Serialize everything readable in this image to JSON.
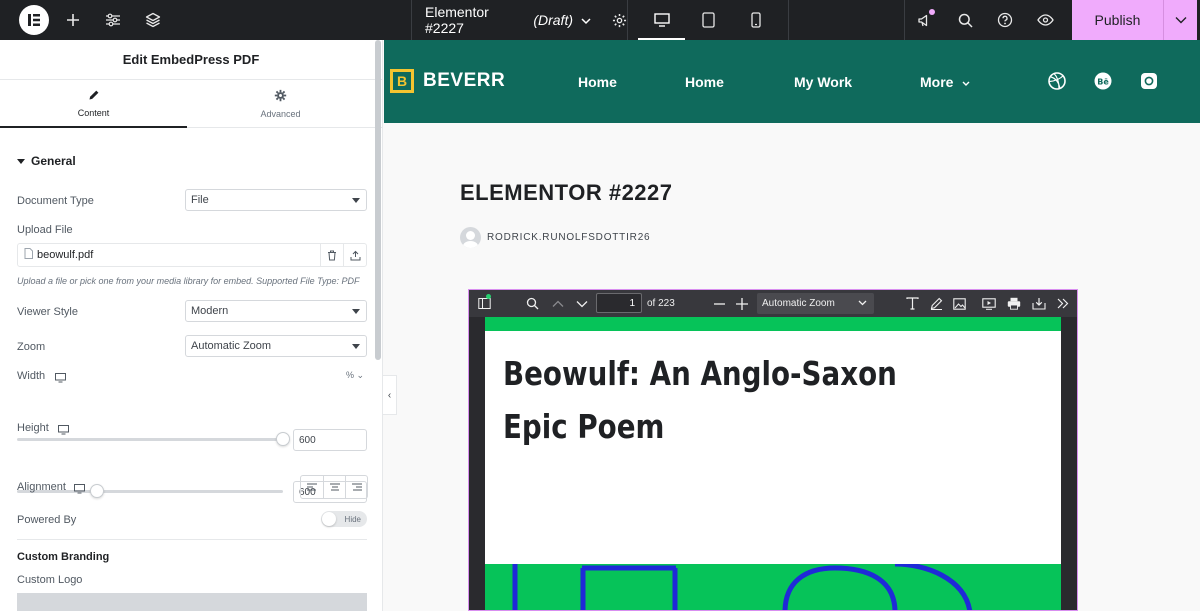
{
  "topbar": {
    "doc_title": "Elementor #2227",
    "doc_status": "(Draft)",
    "publish_label": "Publish"
  },
  "panel": {
    "title": "Edit EmbedPress PDF",
    "tabs": [
      {
        "label": "Content",
        "icon": "pencil-icon"
      },
      {
        "label": "Advanced",
        "icon": "gear-icon"
      }
    ],
    "section_general": "General",
    "document_type": {
      "label": "Document Type",
      "value": "File"
    },
    "upload_file": {
      "label": "Upload File",
      "filename": "beowulf.pdf",
      "help": "Upload a file or pick one from your media library for embed. Supported File Type: PDF"
    },
    "viewer_style": {
      "label": "Viewer Style",
      "value": "Modern"
    },
    "zoom": {
      "label": "Zoom",
      "value": "Automatic Zoom"
    },
    "width": {
      "label": "Width",
      "unit": "%",
      "value": "600",
      "slider_fraction": 1.0
    },
    "height": {
      "label": "Height",
      "value": "600",
      "slider_fraction": 0.3
    },
    "alignment": {
      "label": "Alignment"
    },
    "powered_by": {
      "label": "Powered By",
      "toggle_text": "Hide"
    },
    "custom_branding": "Custom Branding",
    "custom_logo": "Custom Logo"
  },
  "site": {
    "brand_letter": "B",
    "brand_name": "BEVERR",
    "nav": [
      "Home",
      "Home",
      "My Work",
      "More"
    ],
    "socials": [
      "dribbble-icon",
      "behance-icon",
      "instagram-icon"
    ],
    "header_color": "#0f6a5c",
    "accent_color": "#f4c430"
  },
  "post": {
    "title": "ELEMENTOR #2227",
    "author": "RODRICK.RUNOLFSDOTTIR26"
  },
  "pdf": {
    "page_current": "1",
    "page_total": "of 223",
    "zoom": "Automatic Zoom",
    "doc_title": "Beowulf: An Anglo-Saxon Epic Poem",
    "band_color": "#06c359"
  }
}
